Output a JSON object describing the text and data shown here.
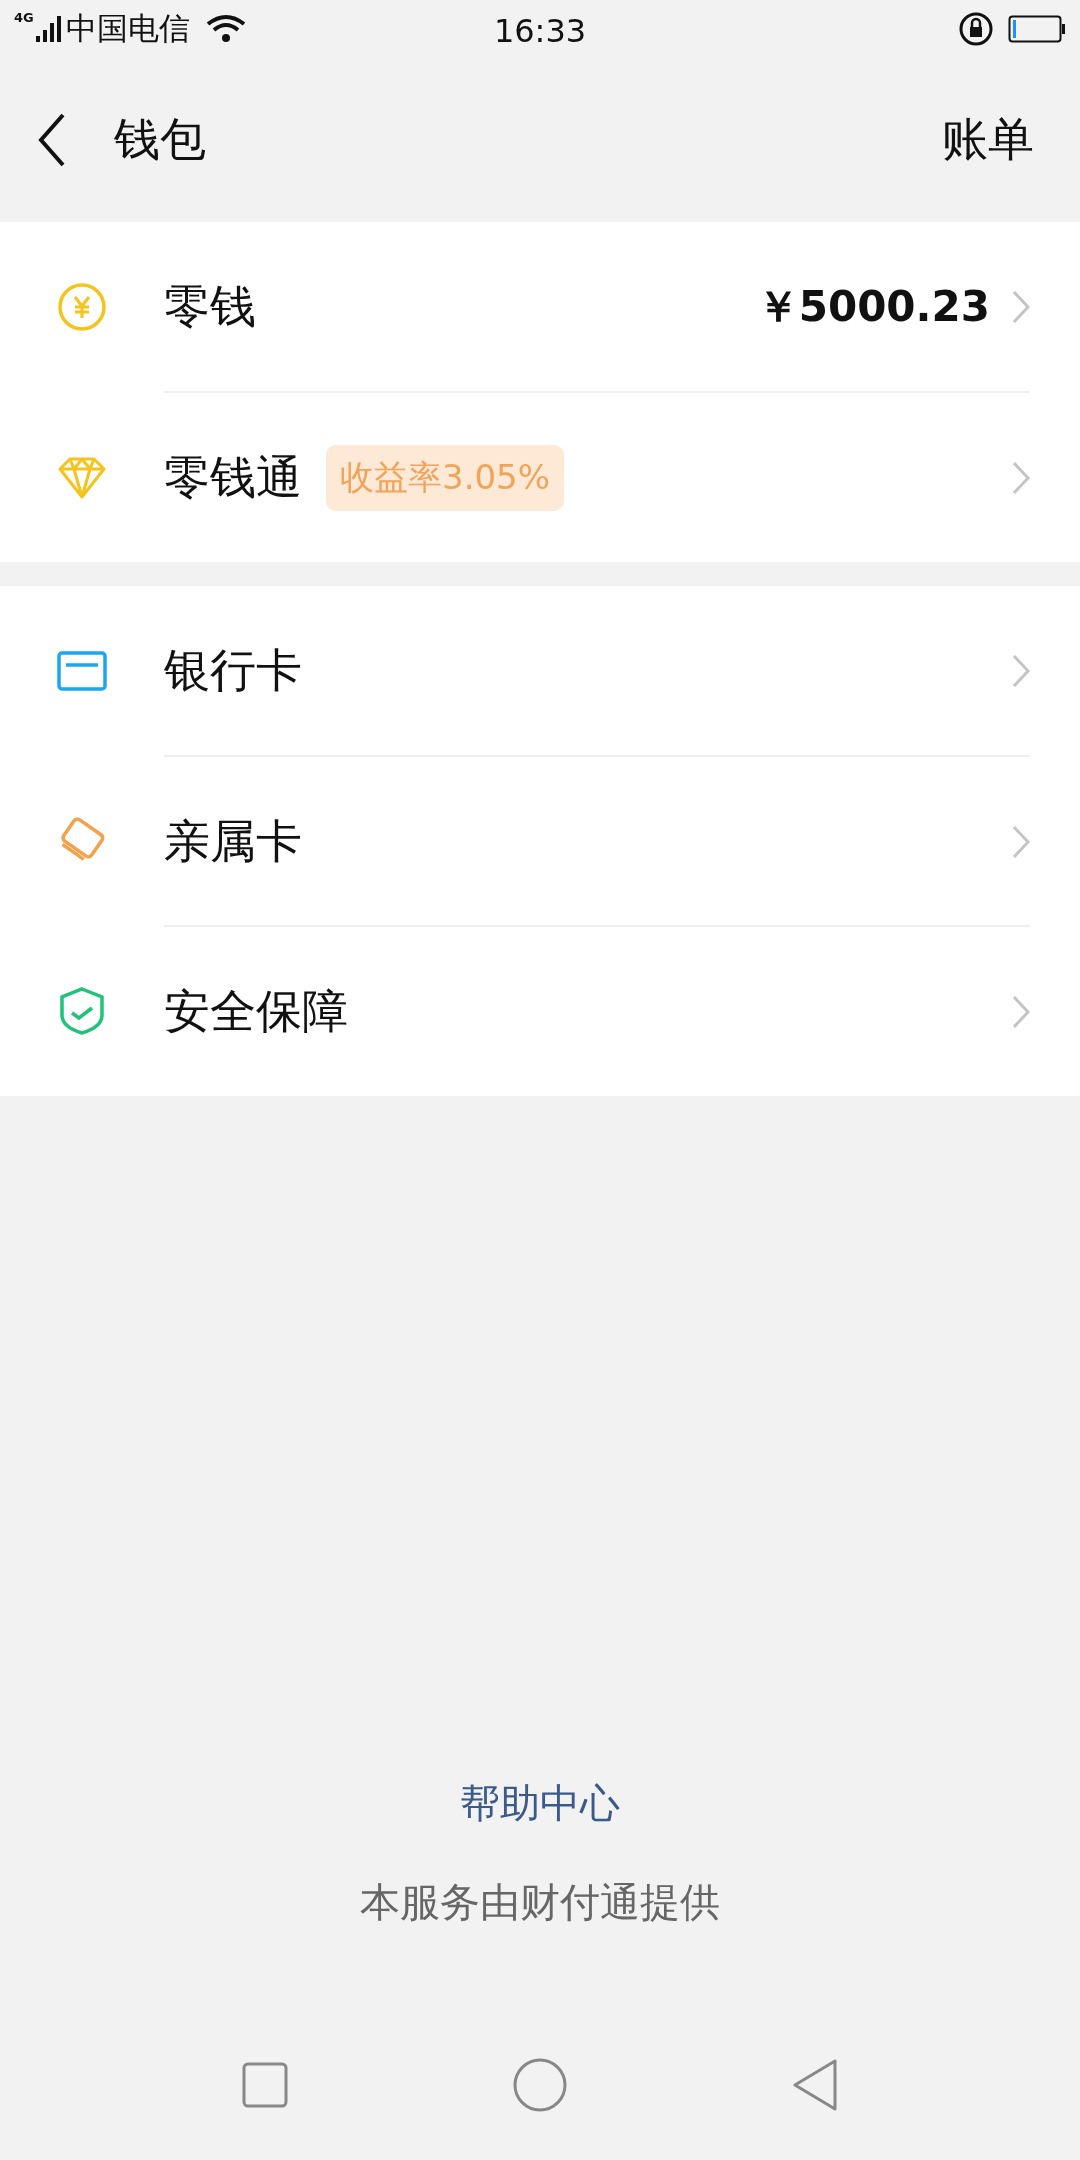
{
  "status_bar": {
    "network": "4G",
    "carrier": "中国电信",
    "time": "16:33"
  },
  "header": {
    "title": "钱包",
    "action": "账单"
  },
  "groups": [
    {
      "items": [
        {
          "label": "零钱",
          "value": "￥5000.23"
        },
        {
          "label": "零钱通",
          "badge": "收益率3.05%"
        }
      ]
    },
    {
      "items": [
        {
          "label": "银行卡"
        },
        {
          "label": "亲属卡"
        },
        {
          "label": "安全保障"
        }
      ]
    }
  ],
  "footer": {
    "link": "帮助中心",
    "note": "本服务由财付通提供"
  }
}
